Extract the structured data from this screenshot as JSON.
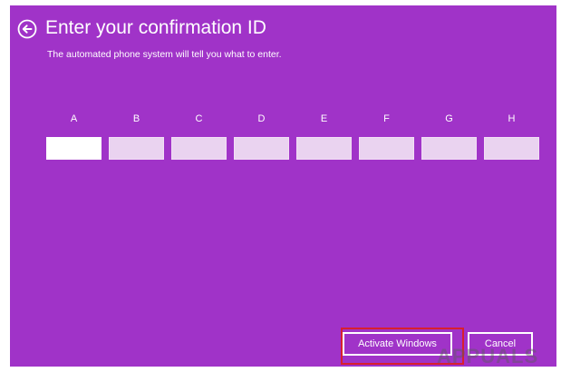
{
  "dialog": {
    "title": "Enter your confirmation ID",
    "subtitle": "The automated phone system will tell you what to enter.",
    "back_icon": "back-arrow-circle-icon"
  },
  "fields": [
    {
      "label": "A",
      "value": "",
      "active": true
    },
    {
      "label": "B",
      "value": "",
      "active": false
    },
    {
      "label": "C",
      "value": "",
      "active": false
    },
    {
      "label": "D",
      "value": "",
      "active": false
    },
    {
      "label": "E",
      "value": "",
      "active": false
    },
    {
      "label": "F",
      "value": "",
      "active": false
    },
    {
      "label": "G",
      "value": "",
      "active": false
    },
    {
      "label": "H",
      "value": "",
      "active": false
    }
  ],
  "buttons": {
    "activate_label": "Activate Windows",
    "cancel_label": "Cancel"
  },
  "watermark": "APPUALS",
  "colors": {
    "background": "#a033c8",
    "field_inactive": "#ead3f0",
    "field_active": "#ffffff",
    "highlight": "#d8202e"
  }
}
